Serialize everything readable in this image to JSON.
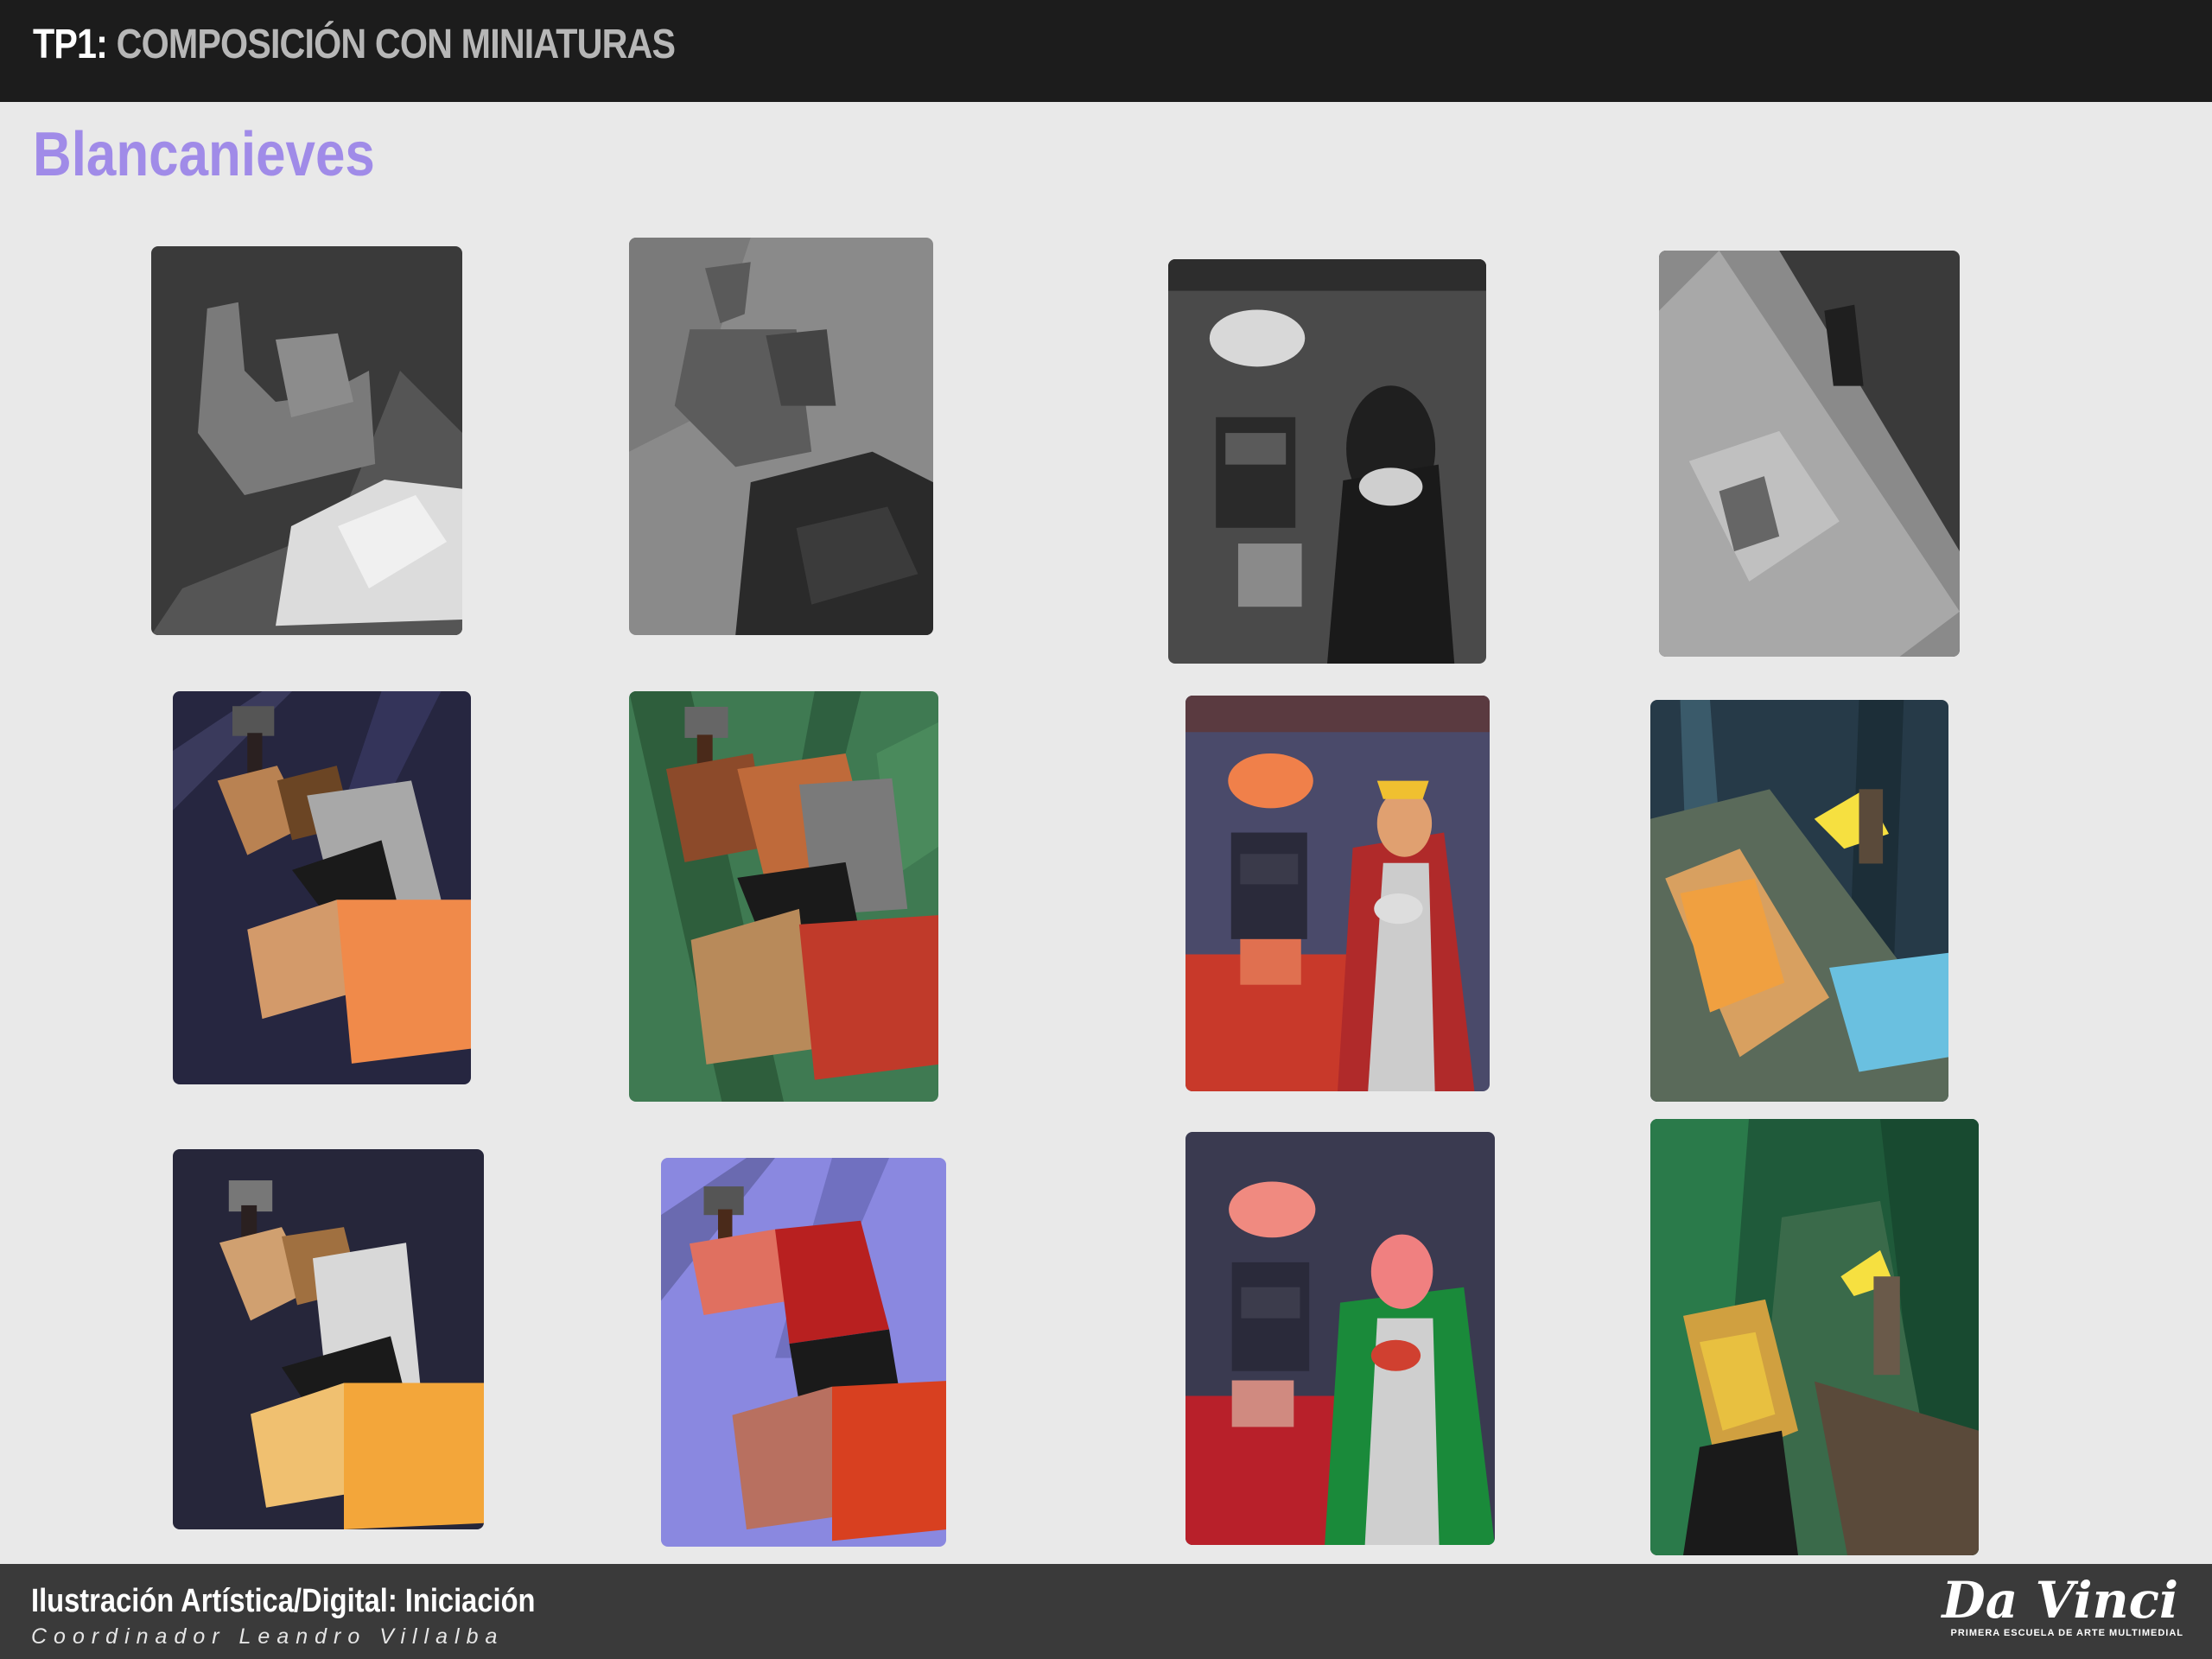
{
  "header": {
    "prefix": "TP1:",
    "title": " COMPOSICIÓN CON MINIATURAS"
  },
  "subtitle": "Blancanieves",
  "footer": {
    "course": "Ilustración Artística/Digital: Iniciación",
    "coordinator": "Coordinador Leandro Villalba"
  },
  "logo": {
    "name": "Da Vinci",
    "tagline": "PRIMERA ESCUELA DE ARTE MULTIMEDIAL"
  },
  "colors": {
    "accent": "#a08be8",
    "topbar": "#1c1c1c",
    "footer": "#3a3a3a",
    "background": "#e9e9e9"
  },
  "thumbnails": [
    {
      "row": 1,
      "col": 1,
      "style": "grayscale",
      "scene": "hunter-and-girl"
    },
    {
      "row": 1,
      "col": 2,
      "style": "grayscale",
      "scene": "hunter-and-girl"
    },
    {
      "row": 1,
      "col": 3,
      "style": "grayscale",
      "scene": "queen-room"
    },
    {
      "row": 1,
      "col": 4,
      "style": "grayscale",
      "scene": "forest-light"
    },
    {
      "row": 2,
      "col": 1,
      "style": "color",
      "scene": "hunter-and-girl"
    },
    {
      "row": 2,
      "col": 2,
      "style": "color",
      "scene": "hunter-and-girl"
    },
    {
      "row": 2,
      "col": 3,
      "style": "color",
      "scene": "queen-room"
    },
    {
      "row": 2,
      "col": 4,
      "style": "color",
      "scene": "forest-light"
    },
    {
      "row": 3,
      "col": 1,
      "style": "color",
      "scene": "hunter-and-girl"
    },
    {
      "row": 3,
      "col": 2,
      "style": "color",
      "scene": "hunter-and-girl"
    },
    {
      "row": 3,
      "col": 3,
      "style": "color",
      "scene": "queen-room"
    },
    {
      "row": 3,
      "col": 4,
      "style": "color",
      "scene": "forest-light"
    }
  ]
}
